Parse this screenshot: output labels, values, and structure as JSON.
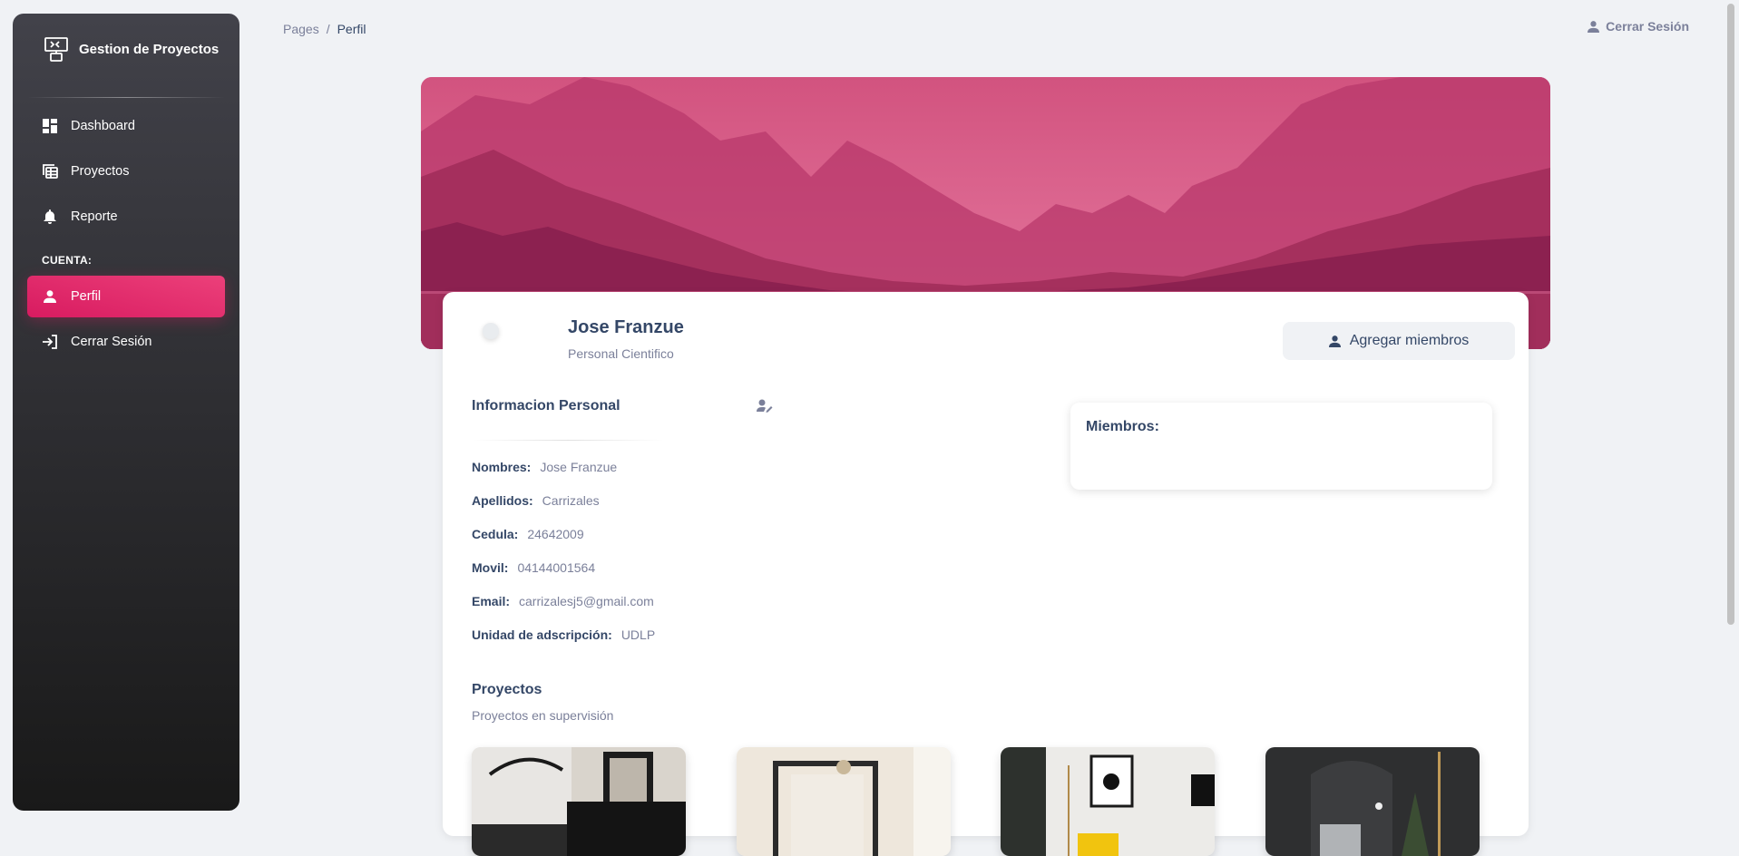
{
  "sidebar": {
    "brand": "Gestion de Proyectos",
    "items": [
      {
        "label": "Dashboard",
        "icon": "dashboard-icon"
      },
      {
        "label": "Proyectos",
        "icon": "table-icon"
      },
      {
        "label": "Reporte",
        "icon": "bell-icon"
      }
    ],
    "section_label": "CUENTA:",
    "account_items": [
      {
        "label": "Perfil",
        "icon": "person-icon",
        "active": true
      },
      {
        "label": "Cerrar Sesión",
        "icon": "login-icon"
      }
    ]
  },
  "breadcrumb": {
    "root": "Pages",
    "separator": "/",
    "current": "Perfil"
  },
  "top_logout": "Cerrar Sesión",
  "profile": {
    "name": "Jose Franzue",
    "role": "Personal Cientifico",
    "add_button": "Agregar miembros"
  },
  "info": {
    "title": "Informacion Personal",
    "rows": [
      {
        "key": "Nombres:",
        "value": "Jose Franzue"
      },
      {
        "key": "Apellidos:",
        "value": "Carrizales"
      },
      {
        "key": "Cedula:",
        "value": "24642009"
      },
      {
        "key": "Movil:",
        "value": "04144001564"
      },
      {
        "key": "Email:",
        "value": "carrizalesj5@gmail.com"
      },
      {
        "key": "Unidad de adscripción:",
        "value": "UDLP"
      }
    ]
  },
  "members": {
    "title": "Miembros:"
  },
  "projects": {
    "title": "Proyectos",
    "subtitle": "Proyectos en supervisión"
  },
  "colors": {
    "accent": "#e91e63",
    "sidebar_dark": "#191919",
    "text": "#344767",
    "muted": "#7b809a"
  }
}
